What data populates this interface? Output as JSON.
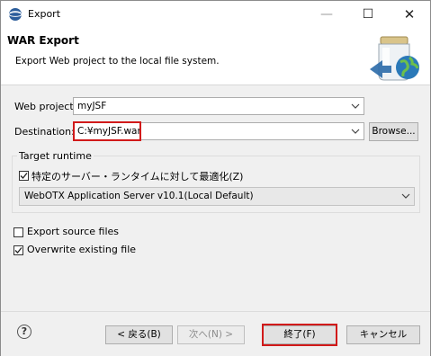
{
  "window": {
    "title": "Export",
    "minimize_glyph": "—",
    "maximize_glyph": "☐",
    "close_glyph": "✕"
  },
  "header": {
    "title": "WAR Export",
    "description": "Export Web project to the local file system."
  },
  "form": {
    "web_project_label": "Web project:",
    "web_project_value": "myJSF",
    "destination_label": "Destination:",
    "destination_value": "C:¥myJSF.war",
    "browse_label": "Browse...",
    "target_runtime": {
      "group_label": "Target runtime",
      "optimize_label": "特定のサーバー・ランタイムに対して最適化(Z)",
      "optimize_checked": true,
      "runtime_value": "WebOTX Application Server v10.1(Local Default)"
    },
    "export_source_label": "Export source files",
    "export_source_checked": false,
    "overwrite_label": "Overwrite existing file",
    "overwrite_checked": true
  },
  "footer": {
    "help_glyph": "?",
    "back_label": "< 戻る(B)",
    "next_label": "次へ(N) >",
    "finish_label": "終了(F)",
    "cancel_label": "キャンセル"
  },
  "colors": {
    "highlight": "#d11a1a",
    "dialog_bg": "#f0f0f0",
    "title_bg": "#ffffff"
  }
}
